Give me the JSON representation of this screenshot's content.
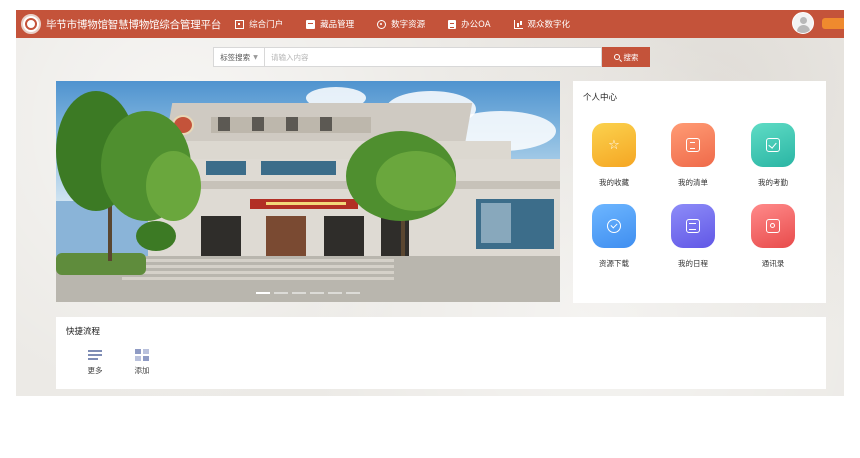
{
  "header": {
    "title": "毕节市博物馆智慧博物馆综合管理平台",
    "nav": [
      {
        "label": "综合门户",
        "icon": "portal-icon"
      },
      {
        "label": "藏品管理",
        "icon": "collection-icon"
      },
      {
        "label": "数字资源",
        "icon": "digital-resource-icon"
      },
      {
        "label": "办公OA",
        "icon": "office-icon"
      },
      {
        "label": "观众数字化",
        "icon": "visitor-analytics-icon"
      }
    ]
  },
  "search": {
    "category": "标签搜索",
    "placeholder": "请输入内容",
    "button": "搜索"
  },
  "banner": {
    "slide_count": 6,
    "active_slide": 1
  },
  "personal_center": {
    "title": "个人中心",
    "tiles": [
      {
        "label": "我的收藏",
        "icon": "star-icon",
        "color": "#f5a623"
      },
      {
        "label": "我的清单",
        "icon": "list-icon",
        "color": "#ef6a4a"
      },
      {
        "label": "我的考勤",
        "icon": "attendance-icon",
        "color": "#2ab5a4"
      },
      {
        "label": "资源下载",
        "icon": "download-icon",
        "color": "#3f8ef0"
      },
      {
        "label": "我的日程",
        "icon": "schedule-icon",
        "color": "#6157e6"
      },
      {
        "label": "通讯录",
        "icon": "contacts-icon",
        "color": "#e84b4b"
      }
    ]
  },
  "quick_flow": {
    "title": "快捷流程",
    "items": [
      {
        "label": "更多",
        "icon": "more-list-icon"
      },
      {
        "label": "添加",
        "icon": "add-grid-icon"
      }
    ]
  },
  "theme": {
    "brand": "#c4533a",
    "accent_badge": "#ef8a2e",
    "background": "#eceae6"
  }
}
